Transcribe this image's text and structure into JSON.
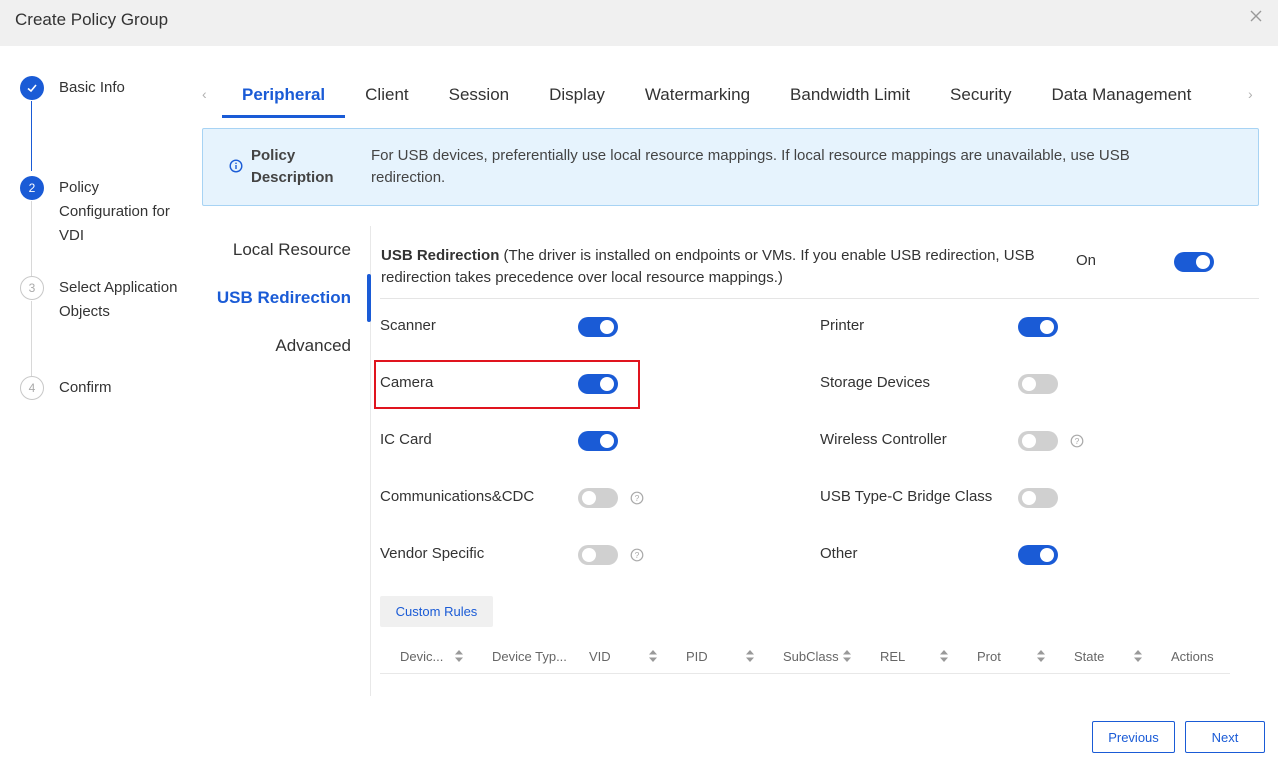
{
  "dialog": {
    "title": "Create Policy Group"
  },
  "steps": [
    {
      "number": "",
      "label": "Basic Info",
      "state": "done"
    },
    {
      "number": "2",
      "label": "Policy Configuration for VDI",
      "state": "active"
    },
    {
      "number": "3",
      "label": "Select Application Objects",
      "state": "pending"
    },
    {
      "number": "4",
      "label": "Confirm",
      "state": "pending"
    }
  ],
  "tabs": [
    "Peripheral",
    "Client",
    "Session",
    "Display",
    "Watermarking",
    "Bandwidth Limit",
    "Security",
    "Data Management"
  ],
  "tab_arrows": {
    "left": "‹",
    "right": "›"
  },
  "policy_description": {
    "label": "Policy Description",
    "text": "For USB devices, preferentially use local resource mappings. If local resource mappings are unavailable, use USB redirection."
  },
  "subnav": [
    "Local Resource",
    "USB Redirection",
    "Advanced"
  ],
  "usb_redirection": {
    "title": "USB Redirection",
    "note": " (The driver is installed on endpoints or VMs. If you enable USB redirection, USB redirection takes precedence over local resource mappings.)",
    "status": "On",
    "enabled": true
  },
  "options_left": [
    {
      "label": "Scanner",
      "on": true,
      "help": false
    },
    {
      "label": "Camera",
      "on": true,
      "help": false
    },
    {
      "label": "IC Card",
      "on": true,
      "help": false
    },
    {
      "label": "Communications&CDC",
      "on": false,
      "help": true
    },
    {
      "label": "Vendor Specific",
      "on": false,
      "help": true
    }
  ],
  "options_right": [
    {
      "label": "Printer",
      "on": true,
      "help": false
    },
    {
      "label": "Storage Devices",
      "on": false,
      "help": false
    },
    {
      "label": "Wireless Controller",
      "on": false,
      "help": true
    },
    {
      "label": "USB Type-C Bridge Class",
      "on": false,
      "help": false
    },
    {
      "label": "Other",
      "on": true,
      "help": false
    }
  ],
  "custom_rules_label": "Custom Rules",
  "table_columns": [
    "Devic...",
    "Device Typ...",
    "VID",
    "PID",
    "SubClass",
    "REL",
    "Prot",
    "State",
    "Actions"
  ],
  "footer": {
    "previous": "Previous",
    "next": "Next"
  },
  "colors": {
    "accent": "#1a5bd6",
    "highlight": "#e0141e",
    "info_bg": "#e6f3fd"
  }
}
